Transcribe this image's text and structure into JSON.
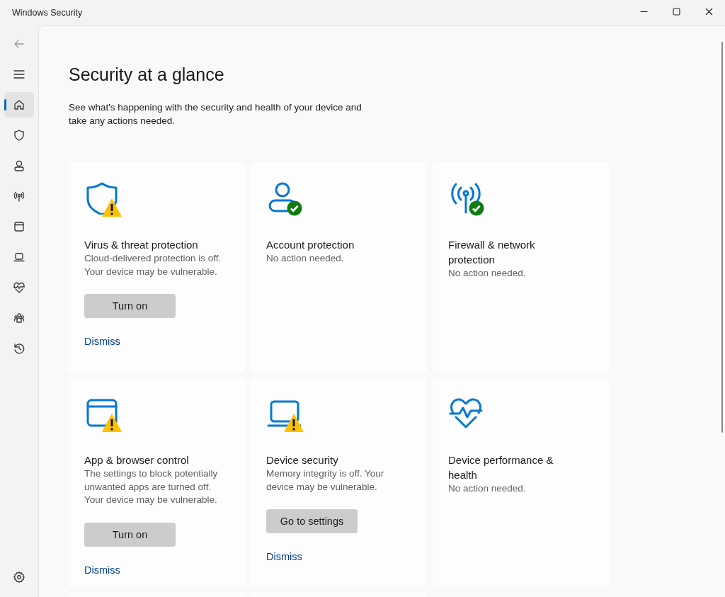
{
  "window": {
    "title": "Windows Security"
  },
  "sidebar": {
    "items": [
      {
        "kind": "back",
        "selected": false
      },
      {
        "kind": "menu",
        "selected": false
      },
      {
        "kind": "home",
        "selected": true
      },
      {
        "kind": "shield",
        "selected": false
      },
      {
        "kind": "person",
        "selected": false
      },
      {
        "kind": "antenna",
        "selected": false
      },
      {
        "kind": "window",
        "selected": false
      },
      {
        "kind": "laptop",
        "selected": false
      },
      {
        "kind": "heart",
        "selected": false
      },
      {
        "kind": "family",
        "selected": false
      },
      {
        "kind": "history",
        "selected": false
      }
    ],
    "settings": {
      "kind": "gear"
    }
  },
  "page": {
    "title": "Security at a glance",
    "subtitle": "See what's happening with the security and health of your device and take any actions needed."
  },
  "cards": [
    {
      "kind": "shield",
      "badge": {
        "kind": "warning"
      },
      "title": "Virus & threat protection",
      "description": "Cloud-delivered protection is off. Your device may be vulnerable.",
      "button": "Turn on",
      "link": "Dismiss"
    },
    {
      "kind": "person",
      "badge": {
        "kind": "ok"
      },
      "title": "Account protection",
      "description": "No action needed."
    },
    {
      "kind": "antenna",
      "badge": {
        "kind": "ok"
      },
      "title": "Firewall & network protection",
      "description": "No action needed."
    },
    {
      "kind": "window",
      "badge": {
        "kind": "warning"
      },
      "title": "App & browser control",
      "description": "The settings to block potentially unwanted apps are turned off. Your device may be vulnerable.",
      "button": "Turn on",
      "link": "Dismiss"
    },
    {
      "kind": "laptop",
      "badge": {
        "kind": "warning"
      },
      "title": "Device security",
      "description": "Memory integrity is off. Your device may be vulnerable.",
      "button": "Go to settings",
      "link": "Dismiss"
    },
    {
      "kind": "heart",
      "title": "Device performance & health",
      "description": "No action needed."
    }
  ]
}
